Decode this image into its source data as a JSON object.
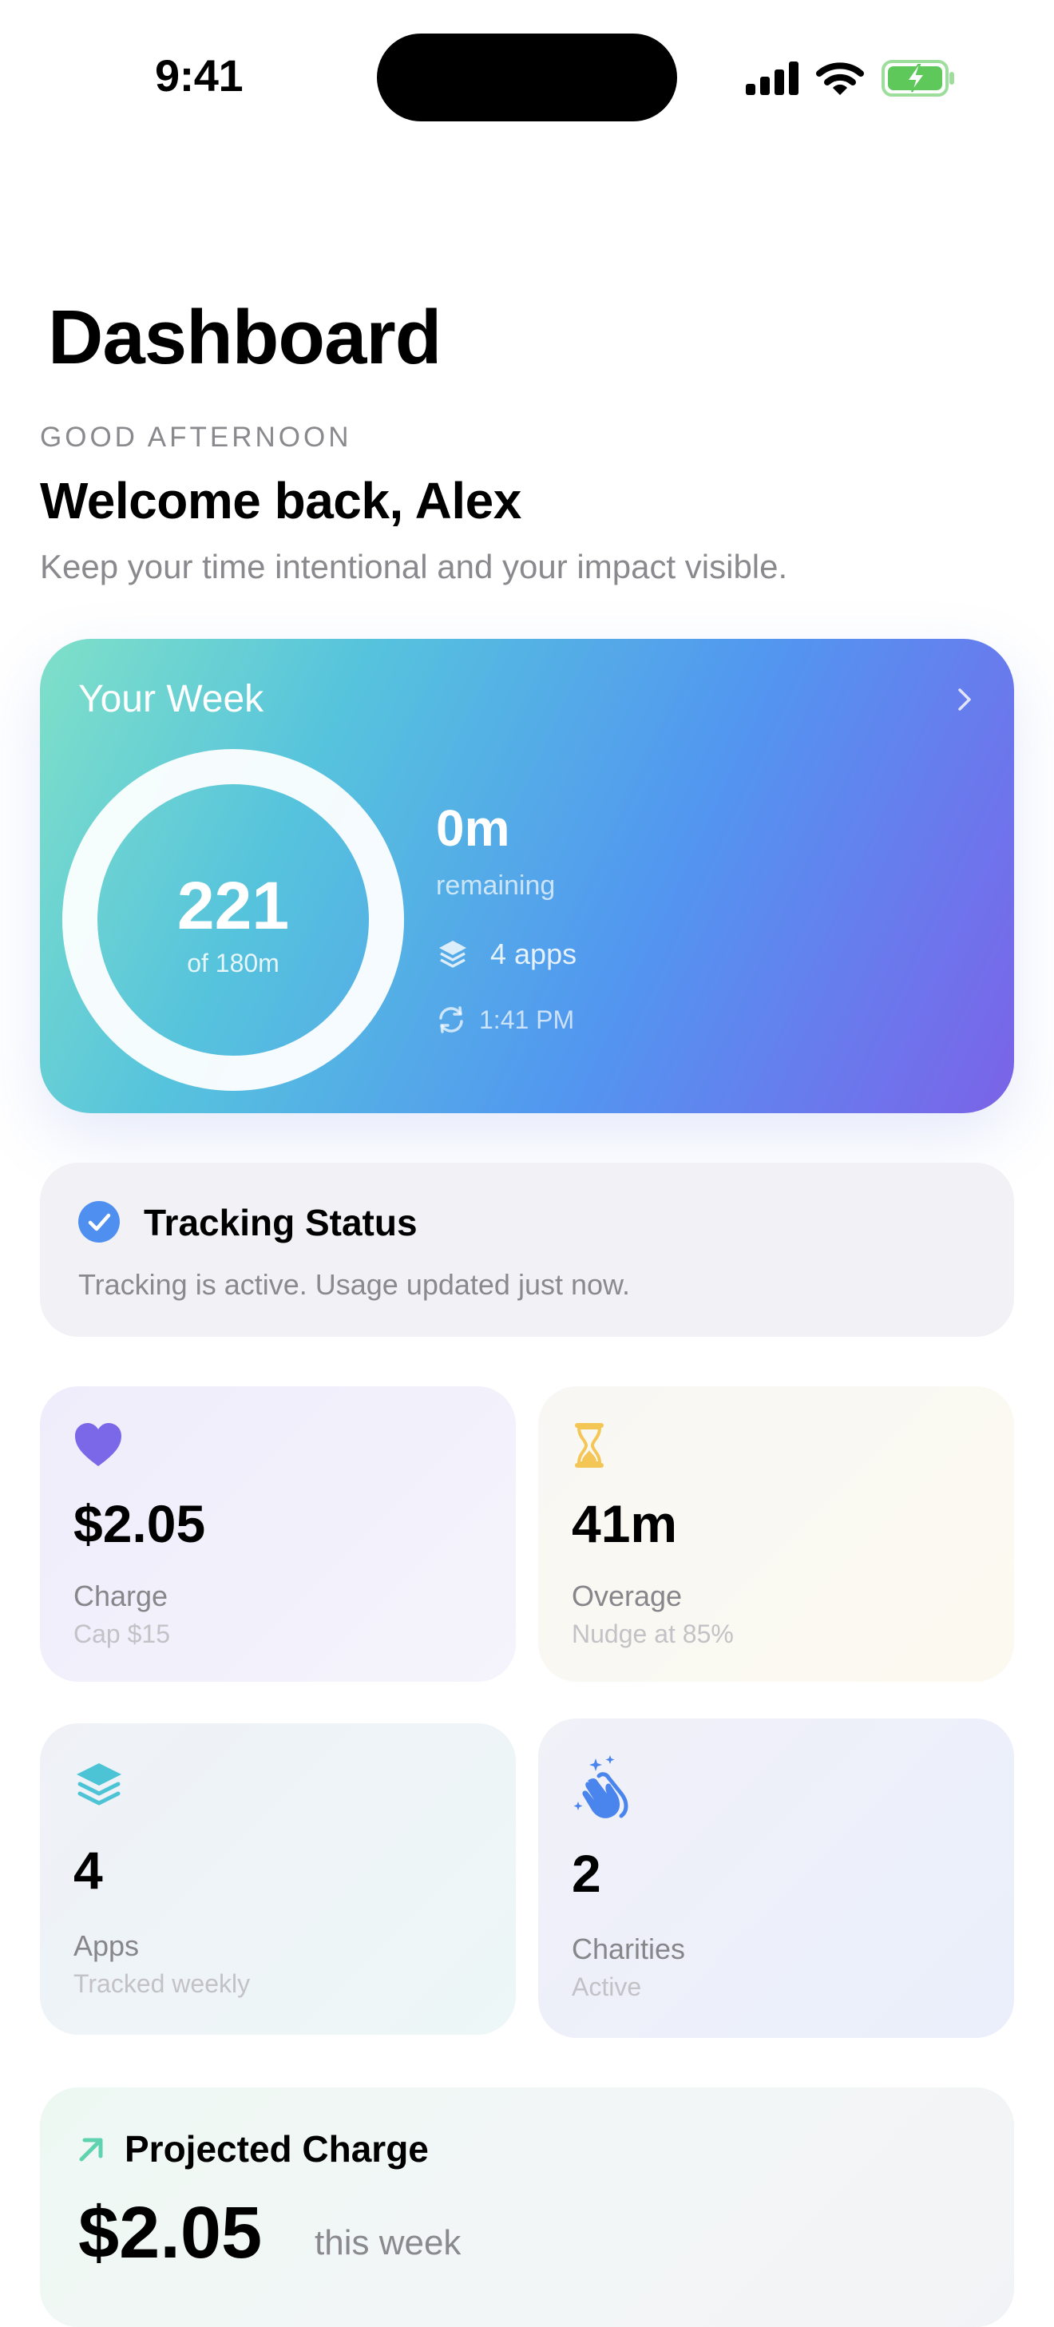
{
  "status_bar": {
    "time": "9:41"
  },
  "header": {
    "title": "Dashboard",
    "greeting": "GOOD AFTERNOON",
    "welcome": "Welcome back, Alex",
    "subtitle": "Keep your time intentional and your impact visible."
  },
  "week_card": {
    "title": "Your Week",
    "ring_value": "221",
    "ring_sub": "of 180m",
    "ring_progress": 1.0,
    "remaining_value": "0m",
    "remaining_label": "remaining",
    "apps_text": "4 apps",
    "sync_time": "1:41 PM",
    "icons": [
      "chevron-right-icon",
      "layers-icon",
      "sync-icon"
    ]
  },
  "tracking": {
    "title": "Tracking Status",
    "description": "Tracking is active. Usage updated just now.",
    "icon": "checkmark-circle-icon",
    "accent": "#4e8ff0"
  },
  "stats": {
    "charge": {
      "value": "$2.05",
      "label": "Charge",
      "sub": "Cap $15",
      "icon": "heart-icon",
      "color": "#7b68e8"
    },
    "overage": {
      "value": "41m",
      "label": "Overage",
      "sub": "Nudge at 85%",
      "icon": "hourglass-icon",
      "color": "#f3c655"
    },
    "apps": {
      "value": "4",
      "label": "Apps",
      "sub": "Tracked weekly",
      "icon": "layers-icon",
      "color": "#4cc4d6"
    },
    "charities": {
      "value": "2",
      "label": "Charities",
      "sub": "Active",
      "icon": "clapping-hands-icon",
      "color": "#4a85ee"
    }
  },
  "projected": {
    "title": "Projected Charge",
    "value": "$2.05",
    "period": "this week",
    "icon": "arrow-up-right-icon",
    "color": "#5fd3b0"
  }
}
